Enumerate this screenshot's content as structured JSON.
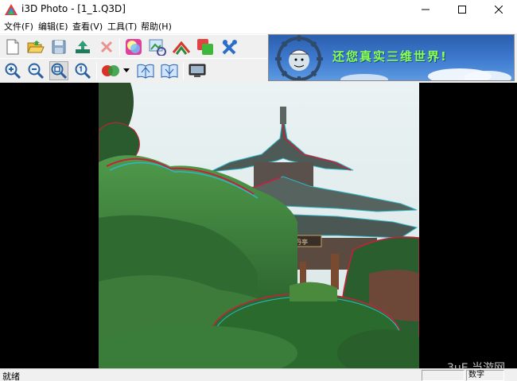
{
  "window": {
    "title": "i3D Photo - [1_1.Q3D]"
  },
  "menu": [
    "文件(F)",
    "编辑(E)",
    "查看(V)",
    "工具(T)",
    "帮助(H)"
  ],
  "banner": {
    "text": "还您真实三维世界!"
  },
  "photo": {
    "sign_text": "拄丹亭",
    "colors": {
      "sky": "#e6eef0",
      "roof": "#4d5a55",
      "foliage": "#2f7a34",
      "red_fringe": "#c8203a",
      "cyan_fringe": "#2fb6c8"
    }
  },
  "status": {
    "left": "就绪",
    "panel": "数字"
  },
  "watermark": "3uE 当游网"
}
